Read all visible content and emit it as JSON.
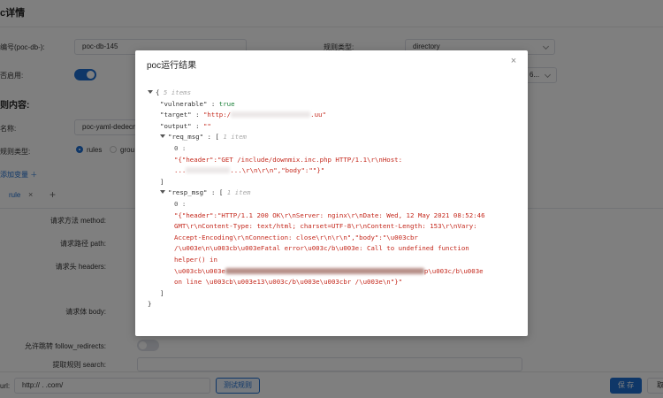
{
  "page": {
    "title": "c详情",
    "poc_id_label": "编号(poc-db-):",
    "poc_id_value": "poc-db-145",
    "rule_type_label": "规则类型:",
    "rule_type_value": "directory",
    "enabled_label": "否启用:",
    "third_select_value": "6...",
    "rule_content_title": "则内容:",
    "name_label": "名称:",
    "name_value": "poc-yaml-dedecms",
    "rule_kind_label": "规则类型:",
    "rule_kind_options": [
      "rules",
      "grou"
    ],
    "add_variable": "添加变量 ＋",
    "tab_label": "rule",
    "tab_close": "×",
    "tab_add": "+",
    "method_label": "请求方法 method:",
    "path_label": "请求路径 path:",
    "headers_label": "请求头 headers:",
    "body_label": "请求体 body:",
    "follow_label": "允许跳转 follow_redirects:",
    "search_label": "提取规则 search:",
    "url_label": "url:",
    "url_value": "http://          .   .com/",
    "test_button": "测试规则",
    "save_button": "保 存",
    "cancel_button": "取"
  },
  "dialog": {
    "title": "poc运行结果",
    "close_glyph": "×",
    "root_open": "{",
    "root_meta": "5 items",
    "vulnerable_key": "\"vulnerable\"",
    "vulnerable_value": "true",
    "target_key": "\"target\"",
    "target_prefix": "\"http:/",
    "target_suffix": ".uu\"",
    "output_key": "\"output\"",
    "output_value": "\"\"",
    "req_key": "\"req_msg\"",
    "req_meta": "1 item",
    "req_index": "0 :",
    "req_line1": "\"{\"header\":\"GET /include/downmix.inc.php HTTP/1.1\\r\\nHost:",
    "req_line2_pre": "...",
    "req_line2_post": "...\\r\\n\\r\\n\",\"body\":\"\"}\"",
    "req_close": "]",
    "resp_key": "\"resp_msg\"",
    "resp_meta": "1 item",
    "resp_index": "0 :",
    "resp_line1": "\"{\"header\":\"HTTP/1.1 200 OK\\r\\nServer: nginx\\r\\nDate: Wed, 12 May 2021 08:52:46",
    "resp_line2": "GMT\\r\\nContent-Type: text/html; charset=UTF-8\\r\\nContent-Length: 153\\r\\nVary:",
    "resp_line3": "Accept-Encoding\\r\\nConnection: close\\r\\n\\r\\n\",\"body\":\"\\u003cbr",
    "resp_line4": "/\\u003e\\n\\u003cb\\u003eFatal error\\u003c/b\\u003e: Call to undefined function",
    "resp_line5": "helper() in",
    "resp_line6_pre": "\\u003cb\\u003e",
    "resp_line6_post": "p\\u003c/b\\u003e",
    "resp_line7": "on line \\u003cb\\u003e13\\u003c/b\\u003e\\u003cbr /\\u003e\\n\"}\"",
    "resp_close": "]",
    "root_close": "}",
    "colon": ":",
    "array_open": "["
  }
}
